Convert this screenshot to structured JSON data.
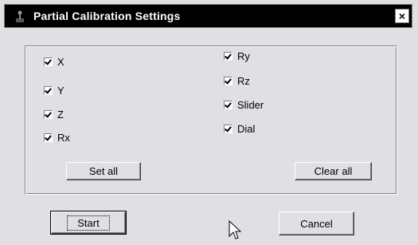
{
  "window": {
    "title": "Partial Calibration Settings",
    "close_glyph": "×"
  },
  "checkboxes": [
    {
      "label": "X",
      "checked": true
    },
    {
      "label": "Y",
      "checked": true
    },
    {
      "label": "Z",
      "checked": true
    },
    {
      "label": "Rx",
      "checked": true
    },
    {
      "label": "Ry",
      "checked": true
    },
    {
      "label": "Rz",
      "checked": true
    },
    {
      "label": "Slider",
      "checked": true
    },
    {
      "label": "Dial",
      "checked": true
    }
  ],
  "buttons": {
    "set_all": "Set all",
    "clear_all": "Clear all",
    "start": "Start",
    "cancel": "Cancel"
  },
  "colors": {
    "dialog_bg": "#e0dfe3",
    "titlebar_bg": "#000000",
    "titlebar_text": "#ffffff"
  }
}
